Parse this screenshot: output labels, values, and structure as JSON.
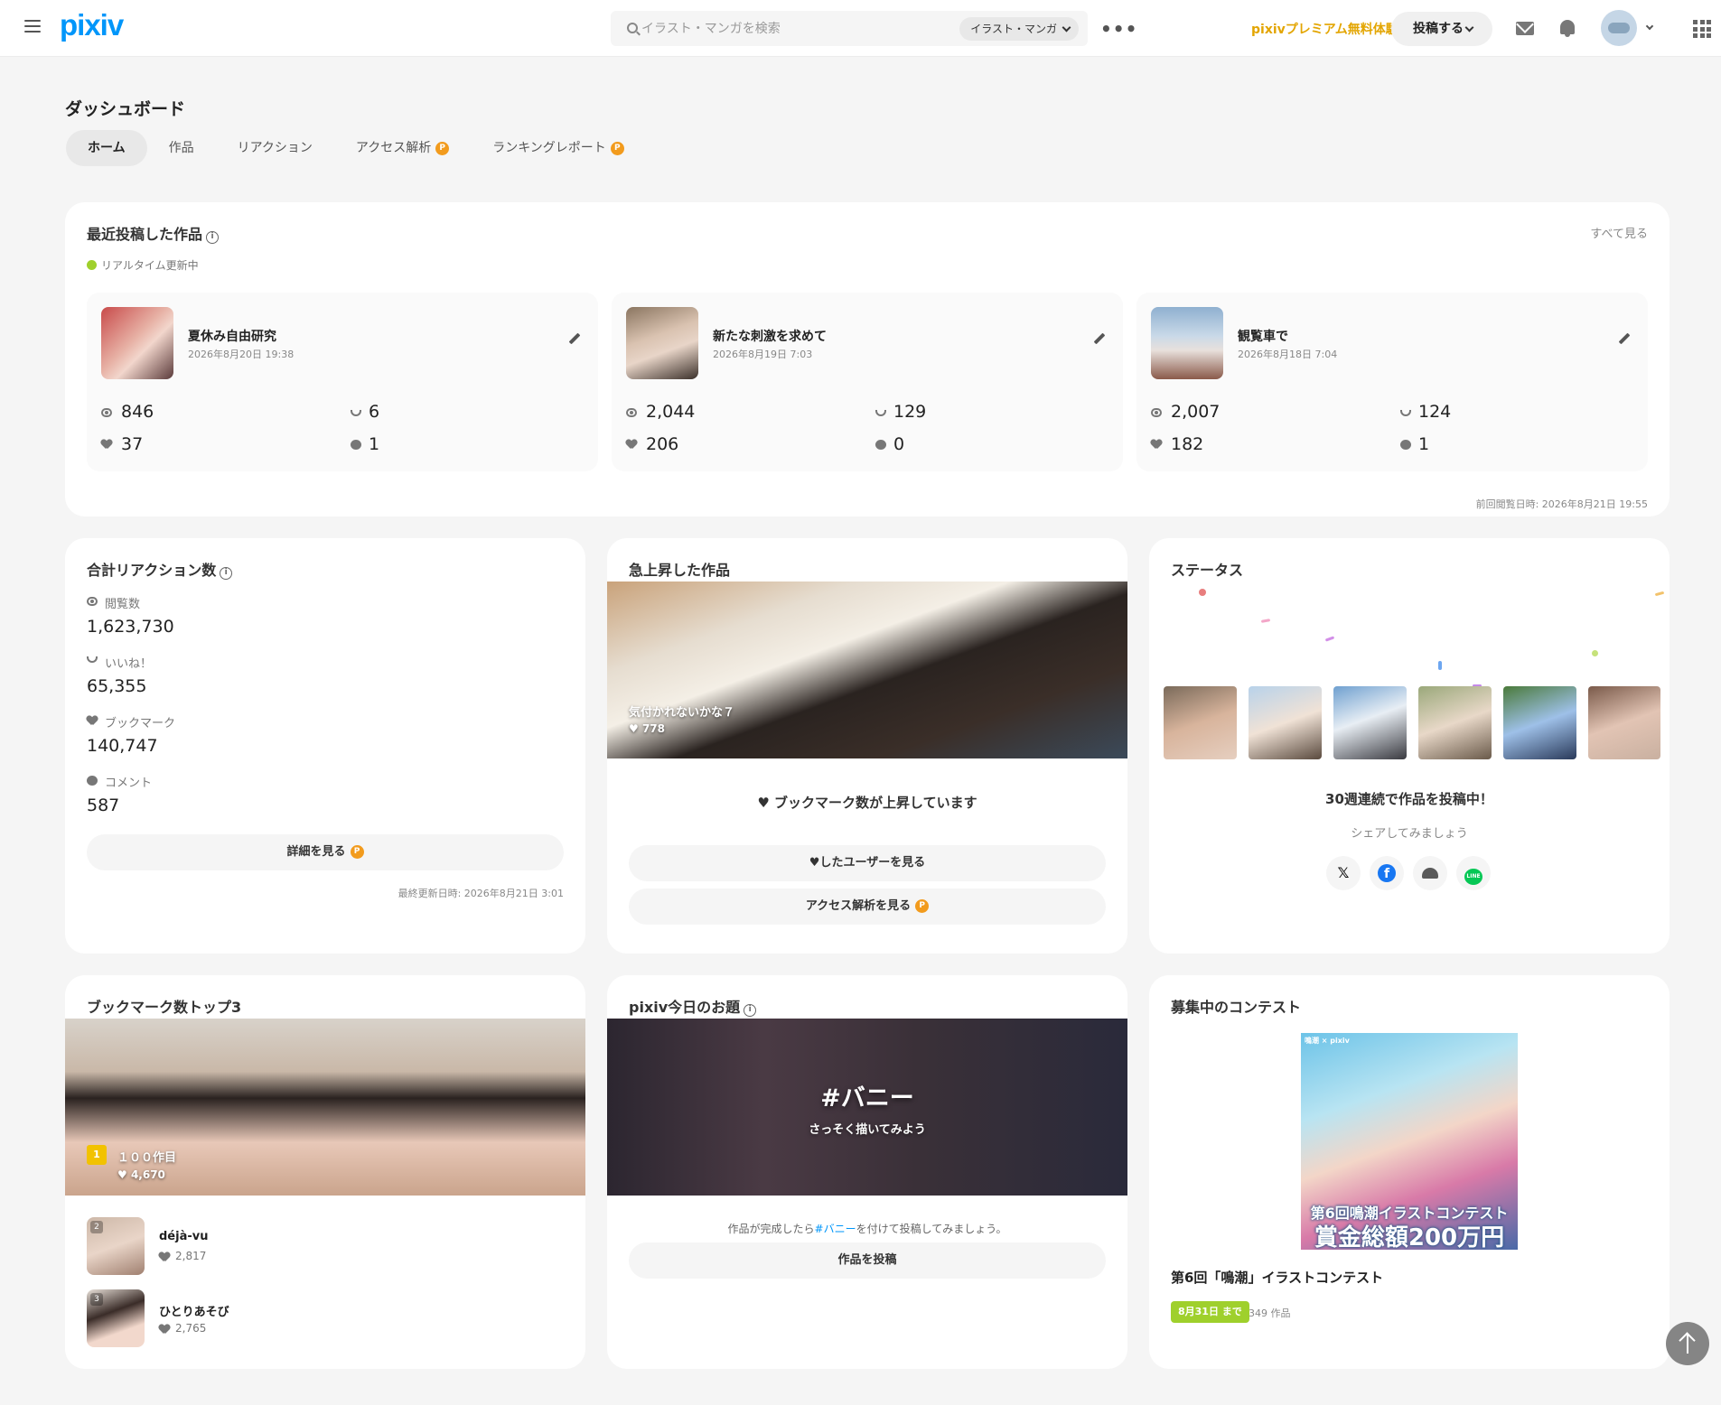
{
  "header": {
    "logo": "pixiv",
    "search_placeholder": "イラスト・マンガを検索",
    "search_category": "イラスト・マンガ",
    "premium": "pixivプレミアム無料体験",
    "post": "投稿する",
    "more": "•••"
  },
  "page": {
    "title": "ダッシュボード",
    "tabs": [
      {
        "label": "ホーム",
        "premium": false
      },
      {
        "label": "作品",
        "premium": false
      },
      {
        "label": "リアクション",
        "premium": false
      },
      {
        "label": "アクセス解析",
        "premium": true
      },
      {
        "label": "ランキングレポート",
        "premium": true
      }
    ],
    "premium_badge": "P"
  },
  "recent": {
    "title": "最近投稿した作品",
    "see_all": "すべて見る",
    "realtime": "リアルタイム更新中",
    "last_viewed": "前回閲覧日時: 2026年8月21日 19:55",
    "works": [
      {
        "title": "夏休み自由研究",
        "date": "2026年8月20日 19:38",
        "views": "846",
        "likes": "6",
        "bookmarks": "37",
        "comments": "1"
      },
      {
        "title": "新たな刺激を求めて",
        "date": "2026年8月19日 7:03",
        "views": "2,044",
        "likes": "129",
        "bookmarks": "206",
        "comments": "0"
      },
      {
        "title": "観覧車で",
        "date": "2026年8月18日 7:04",
        "views": "2,007",
        "likes": "124",
        "bookmarks": "182",
        "comments": "1"
      }
    ]
  },
  "reactions": {
    "title": "合計リアクション数",
    "items": [
      {
        "label": "閲覧数",
        "value": "1,623,730",
        "icon": "eye-icon"
      },
      {
        "label": "いいね！",
        "value": "65,355",
        "icon": "smile-icon"
      },
      {
        "label": "ブックマーク",
        "value": "140,747",
        "icon": "heart-icon"
      },
      {
        "label": "コメント",
        "value": "587",
        "icon": "comment-icon"
      }
    ],
    "detail_button": "詳細を見る",
    "updated": "最終更新日時: 2026年8月21日 3:01"
  },
  "rising": {
    "title": "急上昇した作品",
    "work_title": "気付かれないかな７",
    "work_likes": "778",
    "message": "ブックマーク数が上昇しています",
    "users_button": "♥したユーザーを見る",
    "access_button": "アクセス解析を見る"
  },
  "status": {
    "title": "ステータス",
    "message": "30週連続で作品を投稿中！",
    "share": "シェアしてみましょう",
    "share_icons": [
      "x-icon",
      "facebook-icon",
      "misskey-icon",
      "line-icon"
    ]
  },
  "top3": {
    "title": "ブックマーク数トップ3",
    "items": [
      {
        "rank": "1",
        "title": "１００作目",
        "likes": "4,670"
      },
      {
        "rank": "2",
        "title": "déjà-vu",
        "likes": "2,817"
      },
      {
        "rank": "3",
        "title": "ひとりあそび",
        "likes": "2,765"
      }
    ]
  },
  "theme": {
    "title": "pixiv今日のお題",
    "tag": "#バニー",
    "cta": "さっそく描いてみよう",
    "note_prefix": "作品が完成したら",
    "note_tag": "#バニー",
    "note_suffix": "を付けて投稿してみましょう。",
    "button": "作品を投稿"
  },
  "contest": {
    "title": "募集中のコンテスト",
    "banner_brand": "鳴潮 × pixiv",
    "banner_line1": "第6回鳴潮イラストコンテスト",
    "banner_line2": "賞金総額200万円",
    "name": "第6回「鳴潮」イラストコンテスト",
    "deadline": "8月31日 まで",
    "count": "349 作品"
  },
  "colors": {
    "brand": "#0096fa",
    "premium": "#e3a500",
    "badge": "#f29b1d",
    "live": "#9fd02c"
  }
}
